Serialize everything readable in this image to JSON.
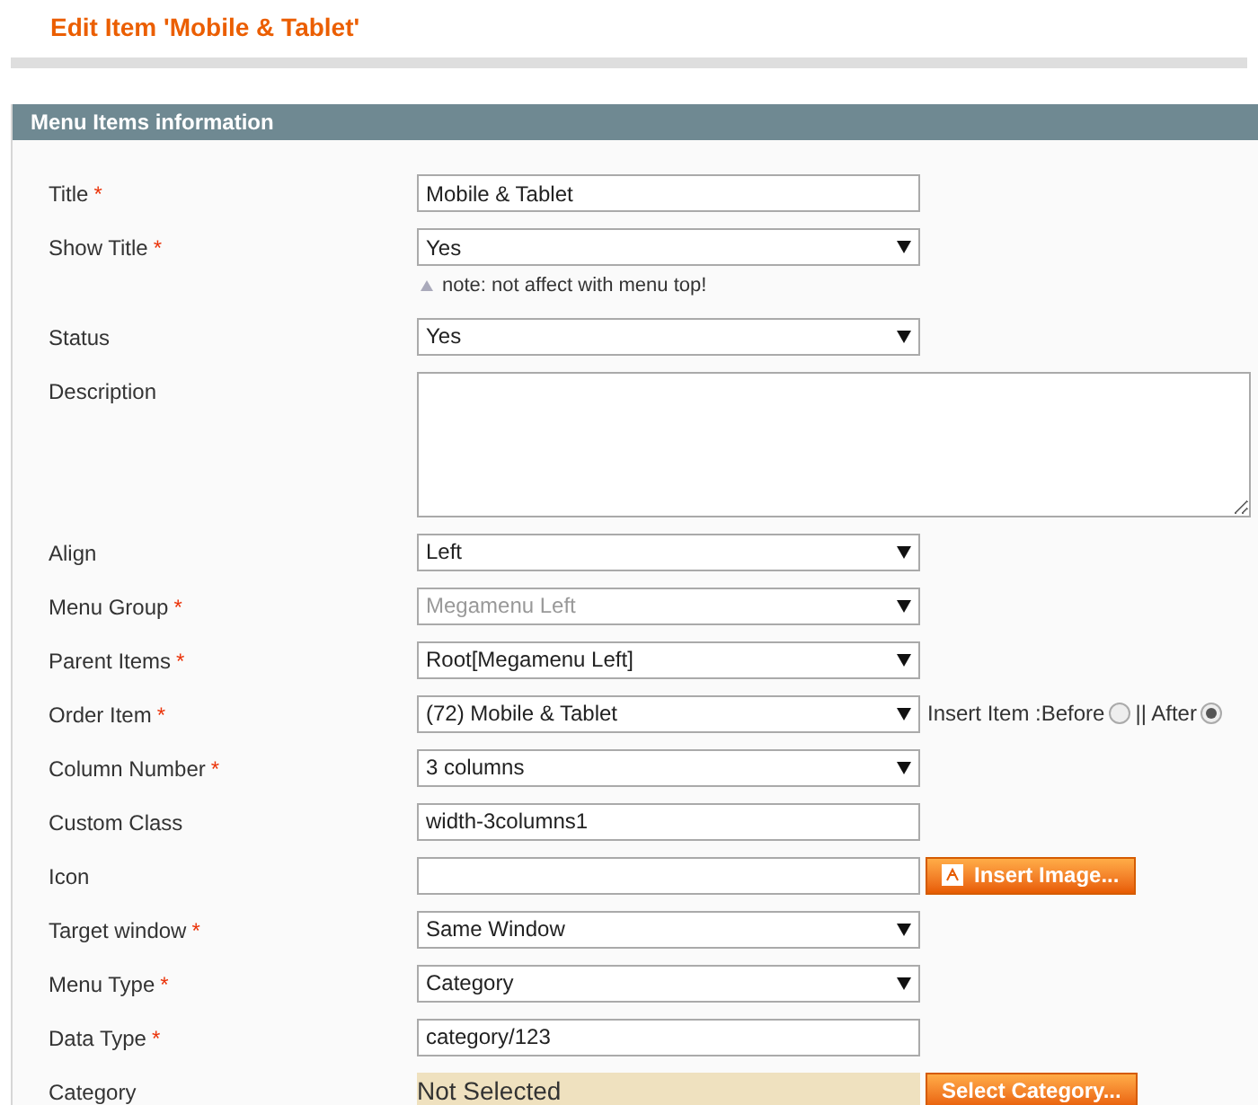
{
  "page_title": "Edit Item 'Mobile & Tablet'",
  "section": {
    "title": "Menu Items information"
  },
  "fields": [
    {
      "kind": "text",
      "label": "Title",
      "mark": "*",
      "value": "Mobile & Tablet"
    },
    {
      "kind": "select",
      "label": "Show Title",
      "mark": "*",
      "value": "Yes",
      "note": "note: not affect with menu top!"
    },
    {
      "kind": "select",
      "label": "Status",
      "value": "Yes"
    },
    {
      "kind": "textarea",
      "label": "Description"
    },
    {
      "kind": "select",
      "label": "Align",
      "value": "Left"
    },
    {
      "kind": "select",
      "label": "Menu Group",
      "mark": "*",
      "value": "Megamenu Left",
      "disabled": true
    },
    {
      "kind": "select",
      "label": "Parent Items",
      "mark": "*",
      "value": "Root[Megamenu Left]"
    },
    {
      "kind": "select",
      "label": "Order Item",
      "mark": "*",
      "value": "(72) Mobile & Tablet",
      "insert": {
        "label": "Insert Item : ",
        "options": [
          {
            "label": "Before",
            "selected": false
          },
          {
            "label": "|| After",
            "selected": true
          }
        ]
      }
    },
    {
      "kind": "select",
      "label": "Column Number",
      "mark": "*",
      "value": "3 columns"
    },
    {
      "kind": "text",
      "label": "Custom Class",
      "value": "width-3columns1"
    },
    {
      "kind": "text",
      "label": "Icon",
      "button": "Insert Image..."
    },
    {
      "kind": "select",
      "label": "Target window",
      "mark": "*",
      "value": "Same Window"
    },
    {
      "kind": "select",
      "label": "Menu Type",
      "mark": "*",
      "value": "Category"
    },
    {
      "kind": "text",
      "label": "Data Type",
      "mark": "*",
      "value": "category/123"
    },
    {
      "kind": "chooser",
      "label": "Category",
      "value": "Not Selected",
      "button": "Select Category..."
    }
  ]
}
